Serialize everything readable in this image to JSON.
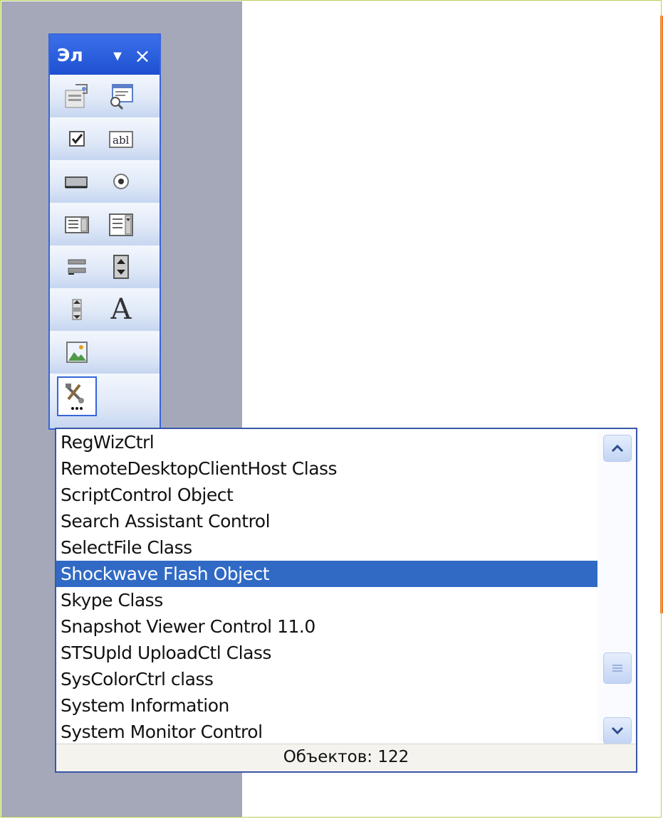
{
  "toolbar": {
    "title": "Эл",
    "dropdown_glyph": "▼",
    "close_glyph": "×",
    "buttons": [
      [
        "properties-icon",
        "view-code-icon"
      ],
      [
        "checkbox-icon",
        "textbox-icon"
      ],
      [
        "command-button-icon",
        "option-button-icon"
      ],
      [
        "listbox-icon",
        "combobox-icon"
      ],
      [
        "toggle-button-icon",
        "spin-button-icon"
      ],
      [
        "scrollbar-icon",
        "label-icon"
      ],
      [
        "image-icon",
        ""
      ],
      [
        "more-controls-icon",
        ""
      ]
    ],
    "label_glyph": "A"
  },
  "object_list": {
    "items": [
      "RegWizCtrl",
      "RemoteDesktopClientHost Class",
      "ScriptControl Object",
      "Search Assistant Control",
      "SelectFile Class",
      "Shockwave Flash Object",
      "Skype Class",
      "Snapshot Viewer Control 11.0",
      "STSUpld UploadCtl Class",
      "SysColorCtrl class",
      "System Information",
      "System Monitor Control"
    ],
    "selected_index": 5,
    "status": "Объектов: 122"
  },
  "colors": {
    "selection": "#316ac5",
    "toolbar_title": "#2a5fe0",
    "panel_gray": "#a4a8b8",
    "accent_orange": "#f07b2a"
  }
}
